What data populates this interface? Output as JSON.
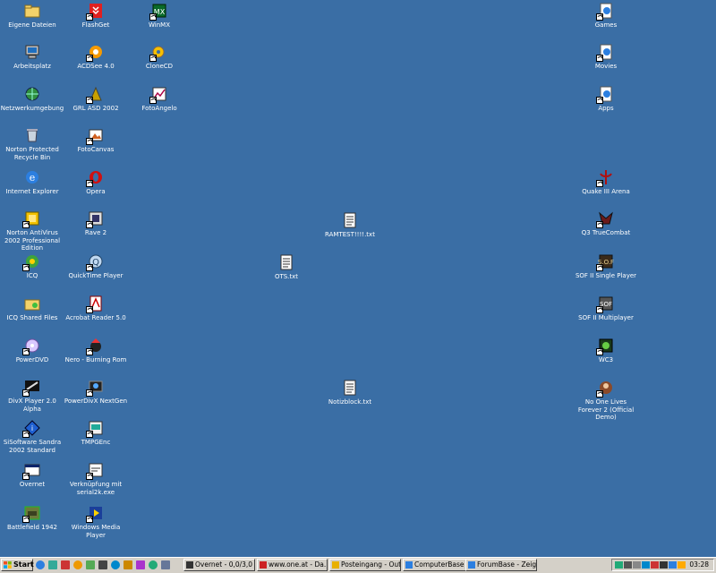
{
  "desktop": {
    "col1": [
      {
        "label": "Eigene Dateien",
        "icon": "folder-icon"
      },
      {
        "label": "Arbeitsplatz",
        "icon": "computer-icon"
      },
      {
        "label": "Netzwerkumgebung",
        "icon": "network-icon"
      },
      {
        "label": "Norton Protected Recycle Bin",
        "icon": "recycle-bin-icon"
      },
      {
        "label": "Internet Explorer",
        "icon": "ie-icon"
      },
      {
        "label": "Norton AntiVirus 2002 Professional Edition",
        "icon": "norton-icon"
      },
      {
        "label": "ICQ",
        "icon": "icq-flower-icon"
      },
      {
        "label": "ICQ Shared Files",
        "icon": "shared-folder-icon"
      },
      {
        "label": "PowerDVD",
        "icon": "dvd-icon"
      },
      {
        "label": "DivX Player 2.0 Alpha",
        "icon": "divx-icon"
      },
      {
        "label": "SiSoftware Sandra 2002 Standard",
        "icon": "sandra-icon"
      },
      {
        "label": "Overnet",
        "icon": "window-icon"
      },
      {
        "label": "Battlefield 1942",
        "icon": "battlefield-icon"
      }
    ],
    "col2": [
      {
        "label": "FlashGet",
        "icon": "flashget-icon"
      },
      {
        "label": "ACDSee 4.0",
        "icon": "acdsee-icon"
      },
      {
        "label": "GRL ASD 2002",
        "icon": "grl-icon"
      },
      {
        "label": "FotoCanvas",
        "icon": "fotocanvas-icon"
      },
      {
        "label": "Opera",
        "icon": "opera-icon"
      },
      {
        "label": "Rave 2",
        "icon": "rave-icon"
      },
      {
        "label": "QuickTime Player",
        "icon": "quicktime-icon"
      },
      {
        "label": "Acrobat Reader 5.0",
        "icon": "acrobat-icon"
      },
      {
        "label": "Nero - Burning Rom",
        "icon": "nero-icon"
      },
      {
        "label": "PowerDivX NextGen",
        "icon": "powerdivx-icon"
      },
      {
        "label": "TMPGEnc",
        "icon": "tmpgenc-icon"
      },
      {
        "label": "Verknüpfung mit serial2k.exe",
        "icon": "exe-icon"
      },
      {
        "label": "Windows Media Player",
        "icon": "media-player-icon"
      }
    ],
    "col3": [
      {
        "label": "WinMX",
        "icon": "winmx-icon"
      },
      {
        "label": "CloneCD",
        "icon": "clonecd-icon"
      },
      {
        "label": "FotoAngelo",
        "icon": "fotoangelo-icon"
      }
    ],
    "middle": [
      {
        "label": "RAMTEST!!!!.txt",
        "icon": "text-file-icon"
      },
      {
        "label": "OTS.txt",
        "icon": "text-file-icon"
      },
      {
        "label": "Notizblock.txt",
        "icon": "text-file-icon"
      }
    ],
    "right": [
      {
        "label": "Games",
        "icon": "ie-shortcut-icon"
      },
      {
        "label": "Movies",
        "icon": "ie-shortcut-icon"
      },
      {
        "label": "Apps",
        "icon": "ie-shortcut-icon"
      },
      {
        "label": "Quake III Arena",
        "icon": "quake-icon"
      },
      {
        "label": "Q3 TrueCombat",
        "icon": "truecombat-icon"
      },
      {
        "label": "SOF II Single Player",
        "icon": "sof-icon"
      },
      {
        "label": "SOF II Multiplayer",
        "icon": "sof-mp-icon"
      },
      {
        "label": "WC3",
        "icon": "wc3-icon"
      },
      {
        "label": "No One Lives Forever 2 (Official Demo)",
        "icon": "nolf-icon"
      }
    ]
  },
  "taskbar": {
    "start_label": "Start",
    "tasks": [
      {
        "label": "Overnet - 0,0/3,0"
      },
      {
        "label": "www.one.at - Da..."
      },
      {
        "label": "Posteingang - Out..."
      },
      {
        "label": "ComputerBase - N..."
      },
      {
        "label": "ForumBase - Zeigt..."
      }
    ],
    "clock": "03:28"
  },
  "colors": {
    "desktop": "#3a6ea5",
    "taskbar": "#d4d0c8"
  }
}
